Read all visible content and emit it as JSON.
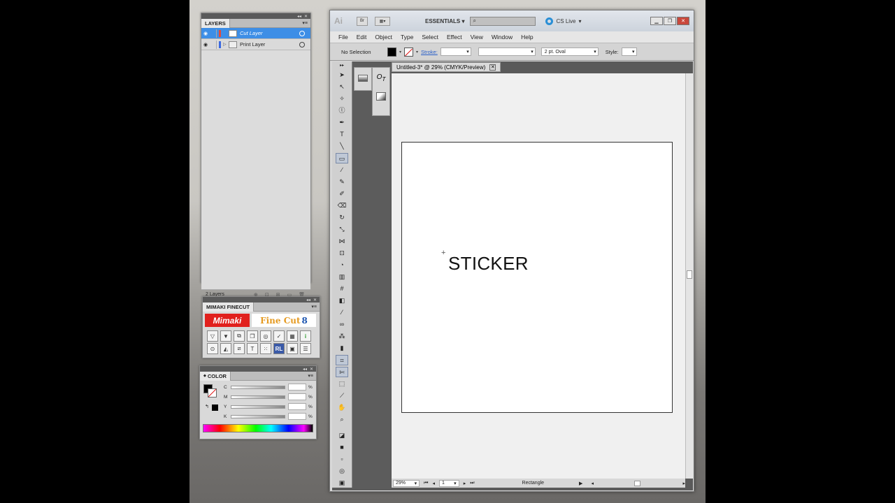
{
  "layers_panel": {
    "tab": "LAYERS",
    "layers": [
      {
        "name": "Cut Layer",
        "selected": true,
        "color": "#e14b3b"
      },
      {
        "name": "Print Layer",
        "selected": false,
        "color": "#3b6ae1"
      }
    ],
    "footer": "2 Layers"
  },
  "finecut_panel": {
    "tab": "MIMAKI FINECUT",
    "mimaki_logo": "Mimaki",
    "finecut_logo_text": "Fine Cut",
    "finecut_logo_version": "8"
  },
  "color_panel": {
    "tab": "COLOR",
    "channels": [
      "C",
      "M",
      "Y",
      "K"
    ],
    "pct": "%"
  },
  "illustrator": {
    "logo": "Ai",
    "br": "Br",
    "workspace": "ESSENTIALS",
    "cs_live": "CS Live",
    "menu": [
      "File",
      "Edit",
      "Object",
      "Type",
      "Select",
      "Effect",
      "View",
      "Window",
      "Help"
    ],
    "control": {
      "selection": "No Selection",
      "stroke_label": "Stroke:",
      "brush": "2 pt. Oval",
      "style_label": "Style:"
    },
    "doc_tab": "Untitled-3* @ 29% (CMYK/Preview)",
    "canvas_text": "STICKER",
    "status": {
      "zoom": "29%",
      "page": "1",
      "tool": "Rectangle"
    }
  }
}
